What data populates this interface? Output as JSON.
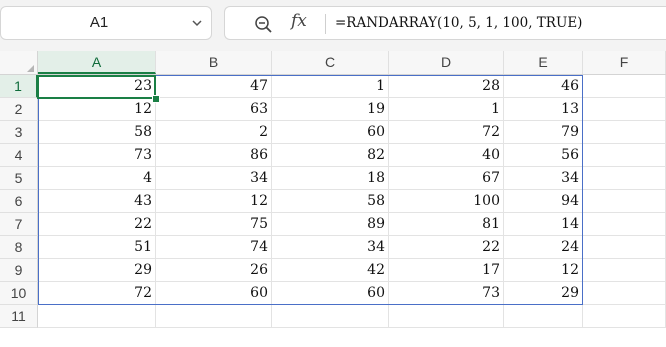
{
  "name_box": {
    "value": "A1"
  },
  "formula_bar": {
    "zoom_icon": "zoom-icon",
    "fx_label": "fx",
    "formula": "=RANDARRAY(10, 5, 1, 100, TRUE)"
  },
  "columns": [
    "A",
    "B",
    "C",
    "D",
    "E",
    "F"
  ],
  "rows": [
    "1",
    "2",
    "3",
    "4",
    "5",
    "6",
    "7",
    "8",
    "9",
    "10",
    "11"
  ],
  "active": {
    "col": "A",
    "row": "1"
  },
  "cells": [
    [
      "23",
      "47",
      "1",
      "28",
      "46"
    ],
    [
      "12",
      "63",
      "19",
      "1",
      "13"
    ],
    [
      "58",
      "2",
      "60",
      "72",
      "79"
    ],
    [
      "73",
      "86",
      "82",
      "40",
      "56"
    ],
    [
      "4",
      "34",
      "18",
      "67",
      "34"
    ],
    [
      "43",
      "12",
      "58",
      "100",
      "94"
    ],
    [
      "22",
      "75",
      "89",
      "81",
      "14"
    ],
    [
      "51",
      "74",
      "34",
      "22",
      "24"
    ],
    [
      "29",
      "26",
      "42",
      "17",
      "12"
    ],
    [
      "72",
      "60",
      "60",
      "73",
      "29"
    ]
  ],
  "colors": {
    "active_green": "#1a7f45",
    "spill_border": "#4a6fc7"
  }
}
